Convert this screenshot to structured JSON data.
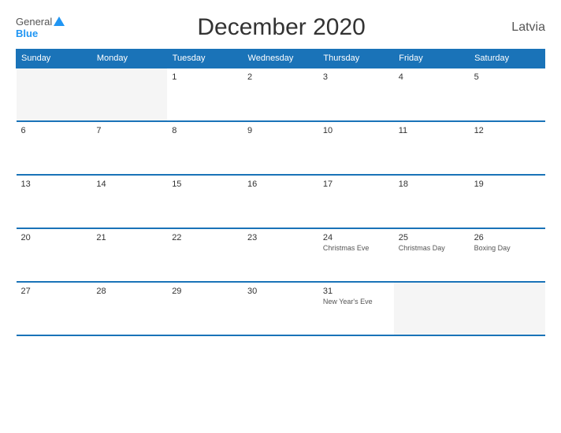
{
  "header": {
    "title": "December 2020",
    "country": "Latvia",
    "logo_general": "General",
    "logo_blue": "Blue"
  },
  "days_of_week": [
    "Sunday",
    "Monday",
    "Tuesday",
    "Wednesday",
    "Thursday",
    "Friday",
    "Saturday"
  ],
  "weeks": [
    [
      {
        "num": "",
        "holiday": "",
        "empty": true
      },
      {
        "num": "",
        "holiday": "",
        "empty": true
      },
      {
        "num": "1",
        "holiday": ""
      },
      {
        "num": "2",
        "holiday": ""
      },
      {
        "num": "3",
        "holiday": ""
      },
      {
        "num": "4",
        "holiday": ""
      },
      {
        "num": "5",
        "holiday": ""
      }
    ],
    [
      {
        "num": "6",
        "holiday": ""
      },
      {
        "num": "7",
        "holiday": ""
      },
      {
        "num": "8",
        "holiday": ""
      },
      {
        "num": "9",
        "holiday": ""
      },
      {
        "num": "10",
        "holiday": ""
      },
      {
        "num": "11",
        "holiday": ""
      },
      {
        "num": "12",
        "holiday": ""
      }
    ],
    [
      {
        "num": "13",
        "holiday": ""
      },
      {
        "num": "14",
        "holiday": ""
      },
      {
        "num": "15",
        "holiday": ""
      },
      {
        "num": "16",
        "holiday": ""
      },
      {
        "num": "17",
        "holiday": ""
      },
      {
        "num": "18",
        "holiday": ""
      },
      {
        "num": "19",
        "holiday": ""
      }
    ],
    [
      {
        "num": "20",
        "holiday": ""
      },
      {
        "num": "21",
        "holiday": ""
      },
      {
        "num": "22",
        "holiday": ""
      },
      {
        "num": "23",
        "holiday": ""
      },
      {
        "num": "24",
        "holiday": "Christmas Eve"
      },
      {
        "num": "25",
        "holiday": "Christmas Day"
      },
      {
        "num": "26",
        "holiday": "Boxing Day"
      }
    ],
    [
      {
        "num": "27",
        "holiday": ""
      },
      {
        "num": "28",
        "holiday": ""
      },
      {
        "num": "29",
        "holiday": ""
      },
      {
        "num": "30",
        "holiday": ""
      },
      {
        "num": "31",
        "holiday": "New Year's Eve"
      },
      {
        "num": "",
        "holiday": "",
        "empty": true
      },
      {
        "num": "",
        "holiday": "",
        "empty": true
      }
    ]
  ]
}
